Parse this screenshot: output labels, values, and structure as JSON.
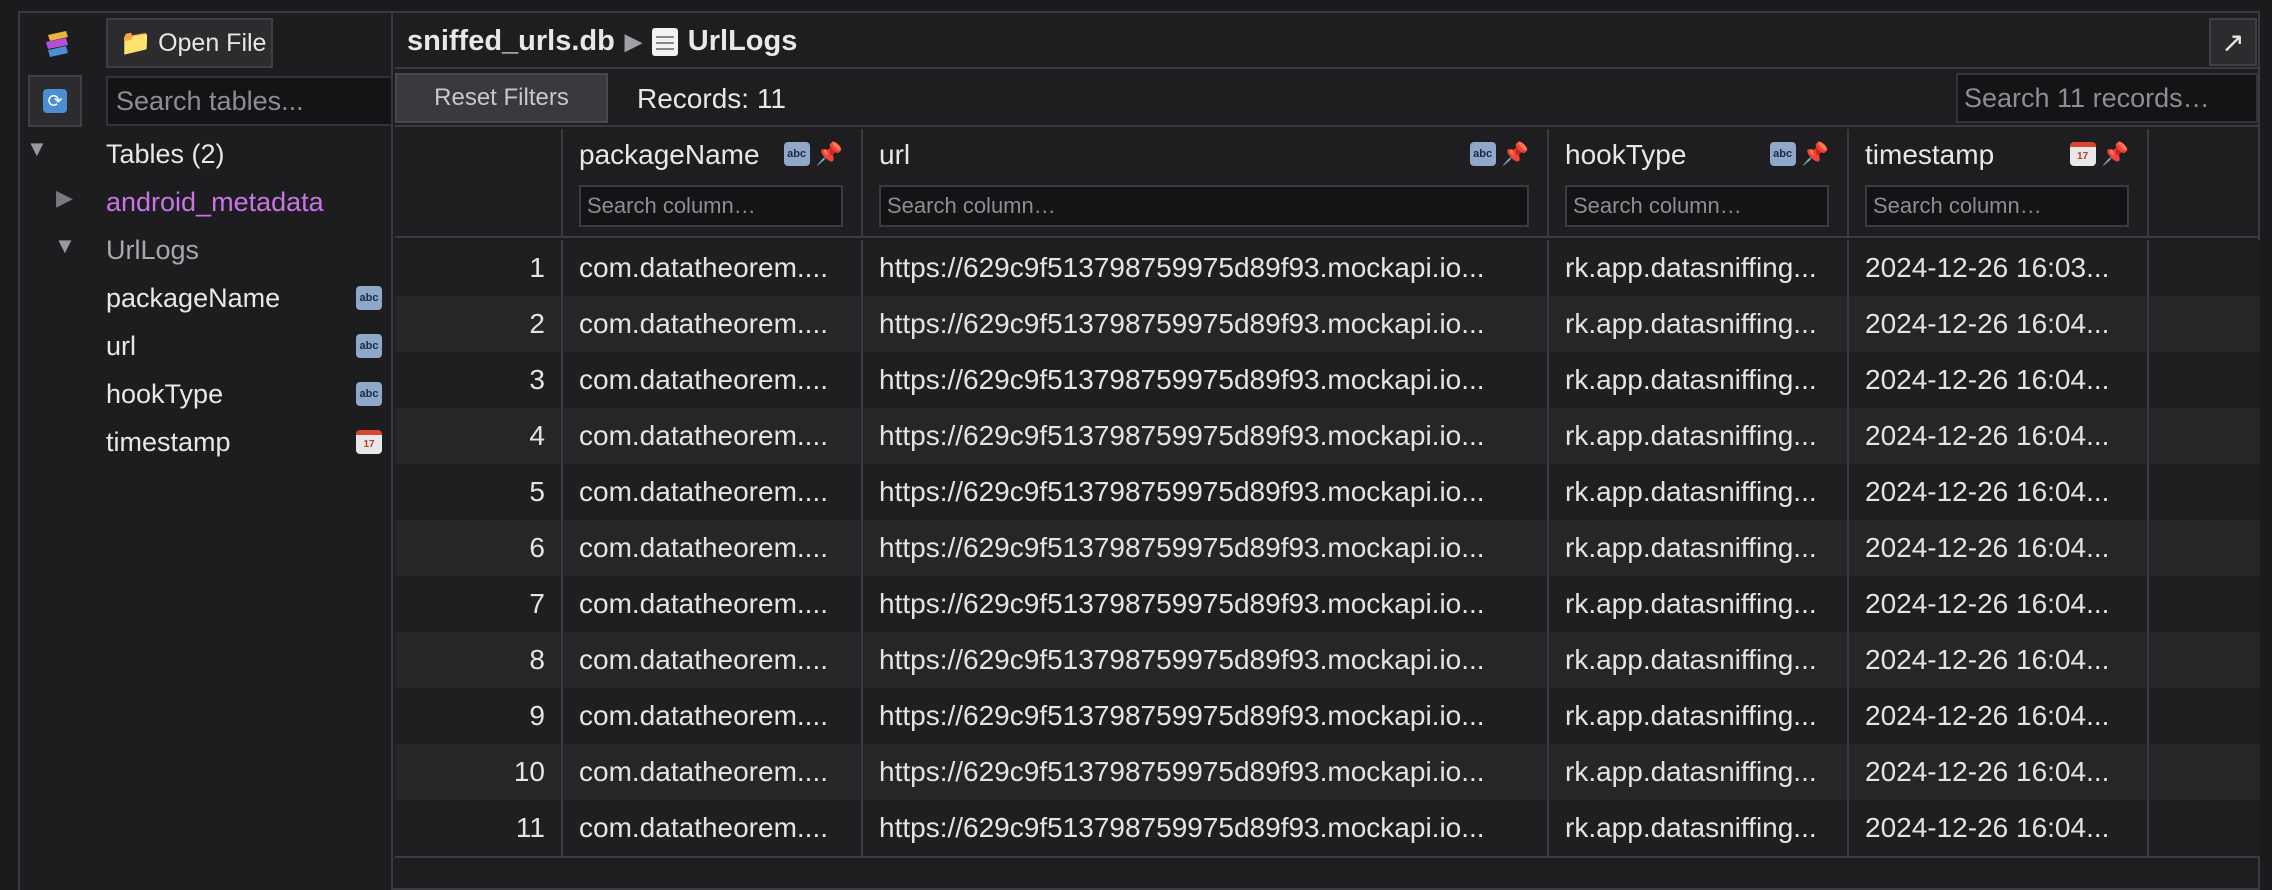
{
  "sidebar": {
    "open_file_label": "📁 Open File",
    "search_placeholder": "Search tables...",
    "tables_header": "Tables (2)",
    "tables": [
      {
        "name": "android_metadata",
        "color": "#c874e8"
      },
      {
        "name": "UrlLogs",
        "color": "#a8a8ac"
      }
    ],
    "columns": [
      {
        "name": "packageName",
        "icon": "abc-icon"
      },
      {
        "name": "url",
        "icon": "abc-icon"
      },
      {
        "name": "hookType",
        "icon": "abc-icon"
      },
      {
        "name": "timestamp",
        "icon": "calendar-icon"
      }
    ],
    "icon_abc_text": "abc",
    "icon_cal_text": "17"
  },
  "header": {
    "db_name": "sniffed_urls.db",
    "separator": "▶",
    "table_name": "UrlLogs",
    "expand_glyph": "↗"
  },
  "toolbar": {
    "reset_label": "Reset Filters",
    "records_label": "Records: 11",
    "search_placeholder": "Search 11 records…"
  },
  "table": {
    "columns": [
      {
        "name": "packageName",
        "icon": "abc-icon",
        "placeholder": "Search column…"
      },
      {
        "name": "url",
        "icon": "abc-icon",
        "placeholder": "Search column…"
      },
      {
        "name": "hookType",
        "icon": "abc-icon",
        "placeholder": "Search column…"
      },
      {
        "name": "timestamp",
        "icon": "calendar-icon",
        "placeholder": "Search column…"
      }
    ],
    "rows": [
      [
        "1",
        "com.datatheorem....",
        "https://629c9f513798759975d89f93.mockapi.io...",
        "rk.app.datasniffing...",
        "2024-12-26 16:03..."
      ],
      [
        "2",
        "com.datatheorem....",
        "https://629c9f513798759975d89f93.mockapi.io...",
        "rk.app.datasniffing...",
        "2024-12-26 16:04..."
      ],
      [
        "3",
        "com.datatheorem....",
        "https://629c9f513798759975d89f93.mockapi.io...",
        "rk.app.datasniffing...",
        "2024-12-26 16:04..."
      ],
      [
        "4",
        "com.datatheorem....",
        "https://629c9f513798759975d89f93.mockapi.io...",
        "rk.app.datasniffing...",
        "2024-12-26 16:04..."
      ],
      [
        "5",
        "com.datatheorem....",
        "https://629c9f513798759975d89f93.mockapi.io...",
        "rk.app.datasniffing...",
        "2024-12-26 16:04..."
      ],
      [
        "6",
        "com.datatheorem....",
        "https://629c9f513798759975d89f93.mockapi.io...",
        "rk.app.datasniffing...",
        "2024-12-26 16:04..."
      ],
      [
        "7",
        "com.datatheorem....",
        "https://629c9f513798759975d89f93.mockapi.io...",
        "rk.app.datasniffing...",
        "2024-12-26 16:04..."
      ],
      [
        "8",
        "com.datatheorem....",
        "https://629c9f513798759975d89f93.mockapi.io...",
        "rk.app.datasniffing...",
        "2024-12-26 16:04..."
      ],
      [
        "9",
        "com.datatheorem....",
        "https://629c9f513798759975d89f93.mockapi.io...",
        "rk.app.datasniffing...",
        "2024-12-26 16:04..."
      ],
      [
        "10",
        "com.datatheorem....",
        "https://629c9f513798759975d89f93.mockapi.io...",
        "rk.app.datasniffing...",
        "2024-12-26 16:04..."
      ],
      [
        "11",
        "com.datatheorem....",
        "https://629c9f513798759975d89f93.mockapi.io...",
        "rk.app.datasniffing...",
        "2024-12-26 16:04..."
      ]
    ]
  }
}
